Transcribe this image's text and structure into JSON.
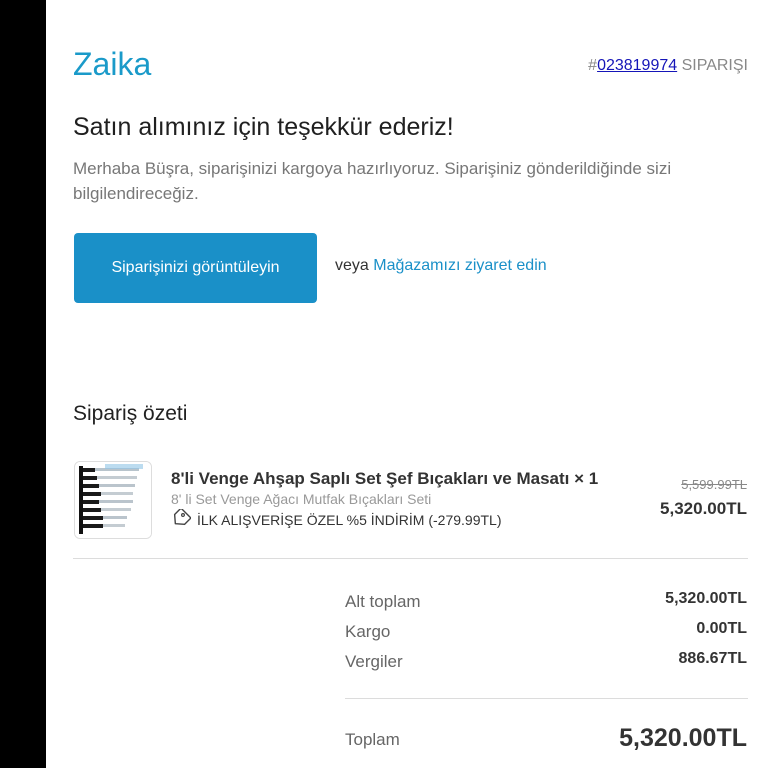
{
  "header": {
    "brand": "Zaika",
    "order_hash": "#",
    "order_number": "023819974",
    "order_suffix": " SIPARIŞI"
  },
  "message": {
    "title": "Satın alımınız için teşekkür ederiz!",
    "body": "Merhaba Büşra, siparişinizi kargoya hazırlıyoruz. Siparişiniz gönderildiğinde sizi bilgilendireceğiz."
  },
  "actions": {
    "view_order_label": "Siparişinizi görüntüleyin",
    "or_text": "veya ",
    "store_link_label": "Mağazamızı ziyaret edin"
  },
  "summary": {
    "title": "Sipariş özeti",
    "item": {
      "title": "8'li Venge Ahşap Saplı Set Şef Bıçakları ve Masatı × 1",
      "variant": "8' li Set Venge Ağacı Mutfak Bıçakları Seti",
      "discount": "İLK ALIŞVERİŞE ÖZEL %5 İNDİRİM (-279.99TL)",
      "original_price": "5,599.99TL",
      "price": "5,320.00TL"
    },
    "totals": {
      "subtotal_label": "Alt toplam",
      "subtotal_value": "5,320.00TL",
      "shipping_label": "Kargo",
      "shipping_value": "0.00TL",
      "taxes_label": "Vergiler",
      "taxes_value": "886.67TL",
      "total_label": "Toplam",
      "total_value": "5,320.00TL"
    }
  },
  "icons": {
    "discount_tag": "tag-icon"
  },
  "colors": {
    "accent": "#1a90c8",
    "brand": "#1a9ac9",
    "link": "#1515b8"
  }
}
